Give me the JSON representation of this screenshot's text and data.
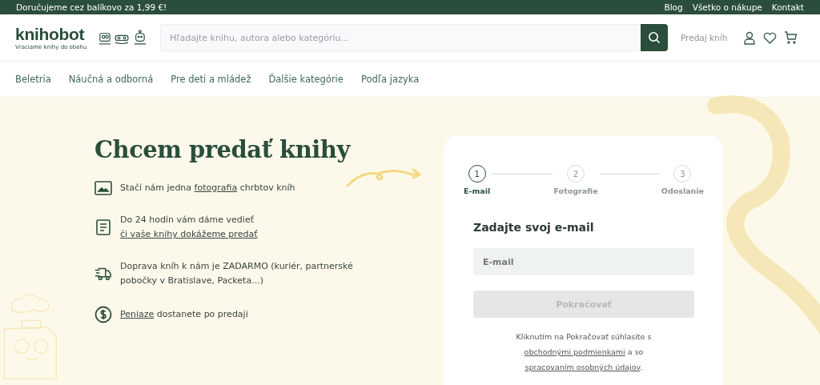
{
  "top_bar": {
    "promo": "Doručujeme cez balíkovo za 1,99 €!",
    "links": [
      "Blog",
      "Všetko o nákupe",
      "Kontakt"
    ]
  },
  "header": {
    "logo": "knihobot",
    "tagline": "Vraciame knihy do obehu",
    "search": {
      "placeholder": "Hľadajte knihu, autora alebo kategóriu..."
    },
    "sell_link": "Predaj kníh"
  },
  "nav": [
    "Beletria",
    "Náučná a odborná",
    "Pre deti a mládež",
    "Ďalšie kategórie",
    "Podľa jazyka"
  ],
  "hero": {
    "title": "Chcem predať knihy",
    "features": [
      {
        "kind": "photo",
        "parts": [
          {
            "text": "Stačí nám jedna ",
            "link": false
          },
          {
            "text": "fotografia",
            "link": true
          },
          {
            "text": " chrbtov kníh",
            "link": false
          }
        ]
      },
      {
        "kind": "document",
        "parts": [
          {
            "text": "Do 24 hodín vám dáme vedieť ",
            "link": false
          },
          {
            "text": "či vaše knihy dokážeme predať",
            "link": true
          }
        ]
      },
      {
        "kind": "truck",
        "parts": [
          {
            "text": "Doprava kníh k nám je ZADARMO (kuriér, partnerské pobočky v Bratislave, Packeta...)",
            "link": false
          }
        ]
      },
      {
        "kind": "money",
        "parts": [
          {
            "text": "Peniaze",
            "link": true
          },
          {
            "text": " dostanete po predaji",
            "link": false
          }
        ]
      }
    ]
  },
  "form": {
    "steps": [
      {
        "number": "1",
        "label": "E-mail",
        "selected": true
      },
      {
        "number": "2",
        "label": "Fotografie",
        "selected": false
      },
      {
        "number": "3",
        "label": "Odoslanie",
        "selected": false
      }
    ],
    "heading": "Zadajte svoj e-mail",
    "email": {
      "placeholder": "E-mail"
    },
    "submit": {
      "label": "Pokračovať",
      "disabled": true
    },
    "terms": [
      {
        "text": "Kliknutím na Pokračovať súhlasite s ",
        "link": false
      },
      {
        "text": "obchodnými podmienkami",
        "link": true
      },
      {
        "text": " a so ",
        "link": false
      },
      {
        "text": "spracovaním osobných údajov",
        "link": true
      },
      {
        "text": ".",
        "link": false
      }
    ]
  }
}
